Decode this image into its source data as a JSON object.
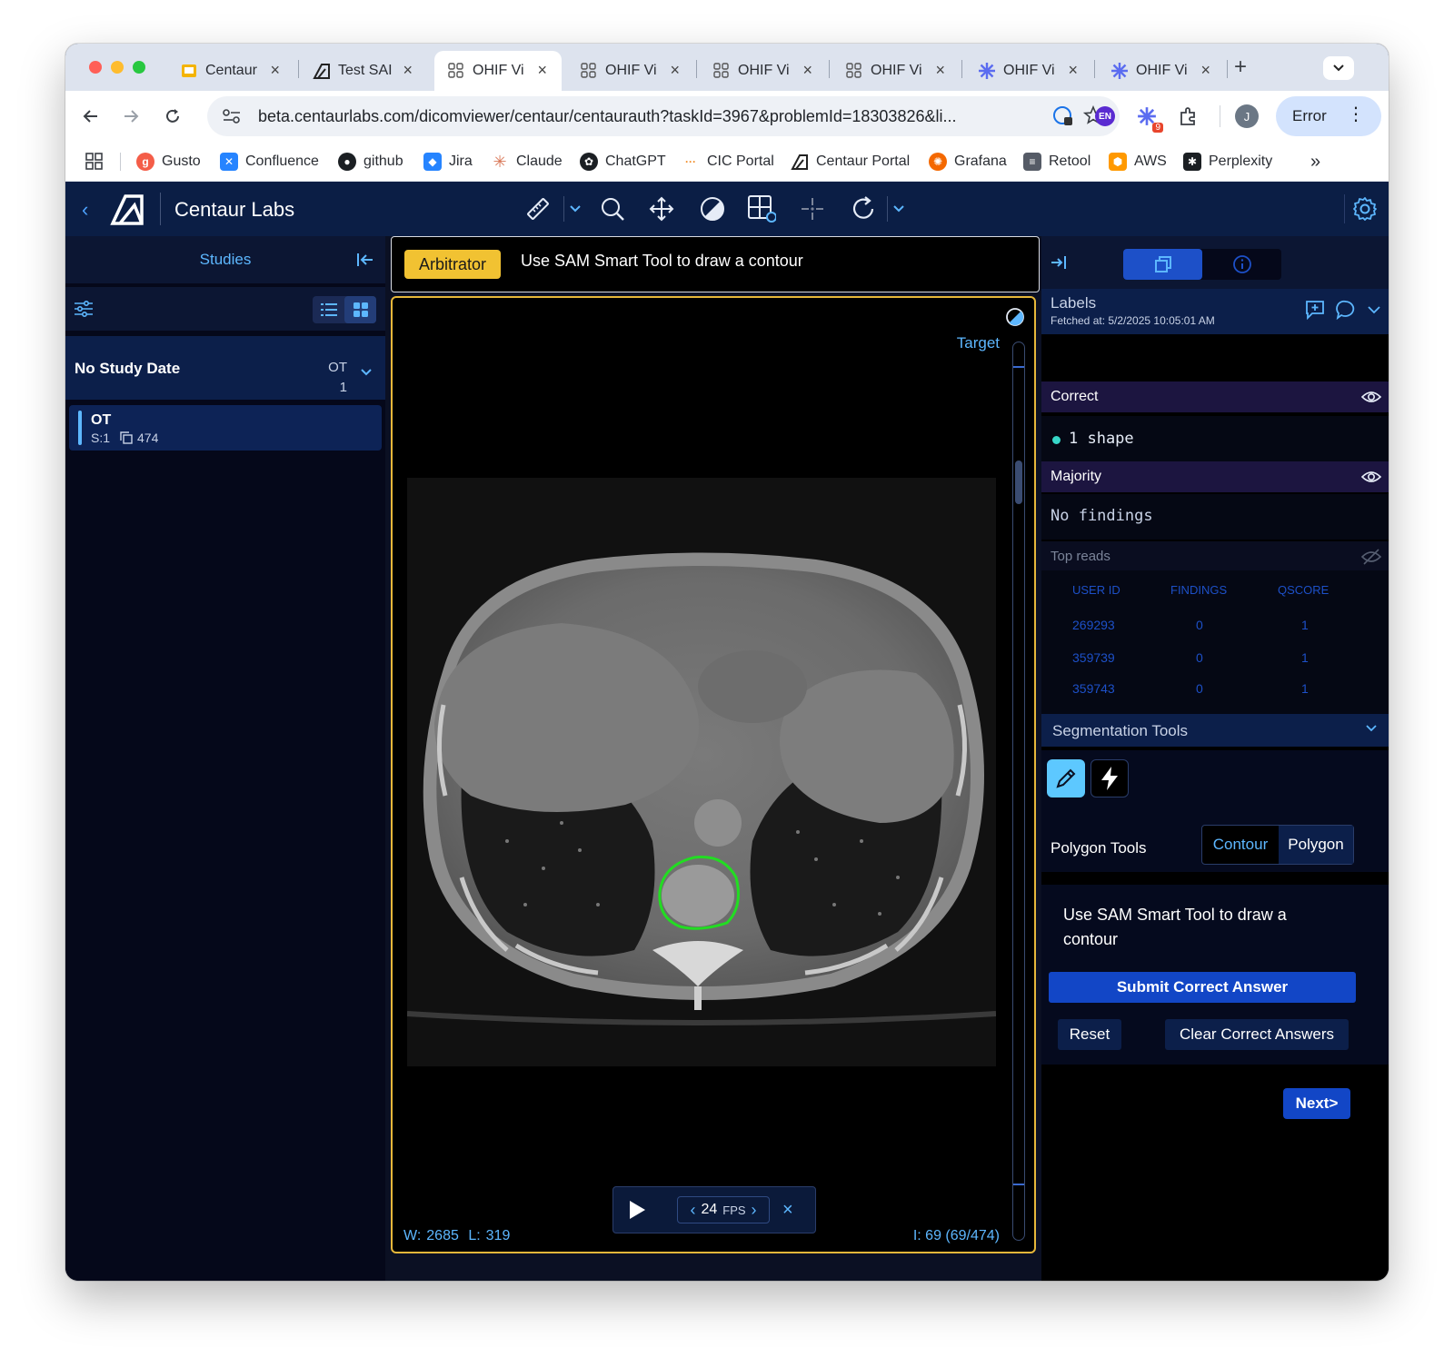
{
  "browser": {
    "tabs": [
      {
        "title": "Centaur",
        "icon": "slides-icon"
      },
      {
        "title": "Test SAI",
        "icon": "centaur-logo-icon"
      },
      {
        "title": "OHIF Vi",
        "icon": "grid-icon",
        "active": true
      },
      {
        "title": "OHIF Vi",
        "icon": "grid-icon"
      },
      {
        "title": "OHIF Vi",
        "icon": "grid-icon"
      },
      {
        "title": "OHIF Vi",
        "icon": "grid-icon"
      },
      {
        "title": "OHIF Vi",
        "icon": "star-burst-icon"
      },
      {
        "title": "OHIF Vi",
        "icon": "star-burst-icon"
      }
    ],
    "new_tab": "+",
    "url": "beta.centaurlabs.com/dicomviewer/centaur/centaurauth?taskId=3967&problemId=18303826&li...",
    "profile_initial": "J",
    "error_label": "Error",
    "extension_badge": "9",
    "lang_badge": "EN",
    "bookmarks": [
      {
        "label": "Gusto",
        "color": "#f45d48"
      },
      {
        "label": "Confluence",
        "color": "#2684ff"
      },
      {
        "label": "github",
        "color": "#1b1f23"
      },
      {
        "label": "Jira",
        "color": "#2684ff"
      },
      {
        "label": "Claude",
        "color": "#d97757"
      },
      {
        "label": "ChatGPT",
        "color": "#1b1f23"
      },
      {
        "label": "CIC Portal",
        "color": "#f08a24"
      },
      {
        "label": "Centaur Portal",
        "color": "#1b1f23"
      },
      {
        "label": "Grafana",
        "color": "#f46800"
      },
      {
        "label": "Retool",
        "color": "#555b66"
      },
      {
        "label": "AWS",
        "color": "#ff9900"
      },
      {
        "label": "Perplexity",
        "color": "#1b1f23"
      }
    ],
    "more_bookmarks": "»"
  },
  "app": {
    "brand": "Centaur Labs",
    "tools": [
      "ruler-icon",
      "zoom-icon",
      "pan-icon",
      "contrast-icon",
      "layout-settings-icon",
      "crosshair-icon",
      "rotate-icon"
    ],
    "accent": "#5db7ff"
  },
  "studies": {
    "title": "Studies",
    "study_date": "No Study Date",
    "modality": "OT",
    "count": "1",
    "series": {
      "modality": "OT",
      "number": "S:1",
      "instances": "474"
    }
  },
  "task": {
    "role": "Arbitrator",
    "instruction": "Use SAM Smart Tool to draw a contour"
  },
  "viewport": {
    "target_label": "Target",
    "window_label": "W:",
    "window_value": "2685",
    "level_label": "L:",
    "level_value": "319",
    "slice_info": "I: 69 (69/474)",
    "fps_value": "24",
    "fps_unit": "FPS",
    "contour_color": "#22dd22",
    "border_color": "#e6b73a"
  },
  "labels": {
    "title": "Labels",
    "fetched": "Fetched at: 5/2/2025 10:05:01 AM",
    "correct_title": "Correct",
    "correct_item": "1 shape",
    "majority_title": "Majority",
    "majority_item": "No findings",
    "top_reads_title": "Top reads",
    "columns": [
      "USER ID",
      "FINDINGS",
      "QSCORE"
    ],
    "rows": [
      [
        "269293",
        "0",
        "1"
      ],
      [
        "359739",
        "0",
        "1"
      ],
      [
        "359743",
        "0",
        "1"
      ]
    ]
  },
  "segmentation": {
    "title": "Segmentation Tools",
    "polygon_label": "Polygon Tools",
    "contour_option": "Contour",
    "polygon_option": "Polygon",
    "message": "Use SAM Smart Tool to draw a contour",
    "submit": "Submit Correct Answer",
    "reset": "Reset",
    "clear": "Clear Correct Answers",
    "next": "Next>"
  }
}
